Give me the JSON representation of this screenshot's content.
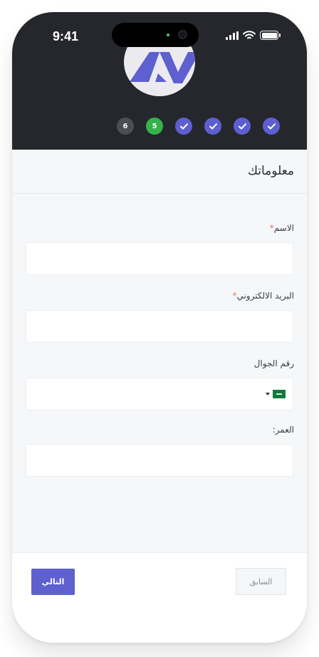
{
  "status_bar": {
    "time": "9:41"
  },
  "steps": [
    {
      "label": "6",
      "state": "pending"
    },
    {
      "label": "5",
      "state": "current"
    },
    {
      "label": "",
      "state": "done"
    },
    {
      "label": "",
      "state": "done"
    },
    {
      "label": "",
      "state": "done"
    },
    {
      "label": "",
      "state": "done"
    }
  ],
  "page": {
    "title": "معلوماتك"
  },
  "form": {
    "name": {
      "label": "الاسم",
      "required_mark": "*",
      "value": ""
    },
    "email": {
      "label": "البريد الالكتروني",
      "required_mark": "*",
      "value": ""
    },
    "mobile": {
      "label": "رقم الجوال",
      "value": ""
    },
    "age": {
      "label": "العمر:",
      "value": ""
    }
  },
  "footer": {
    "next_label": "التالي",
    "prev_label": "السابق"
  },
  "colors": {
    "header": "#25272c",
    "accent": "#5e60cf",
    "current_step": "#36b24a",
    "pending_step": "#4b4e57"
  }
}
